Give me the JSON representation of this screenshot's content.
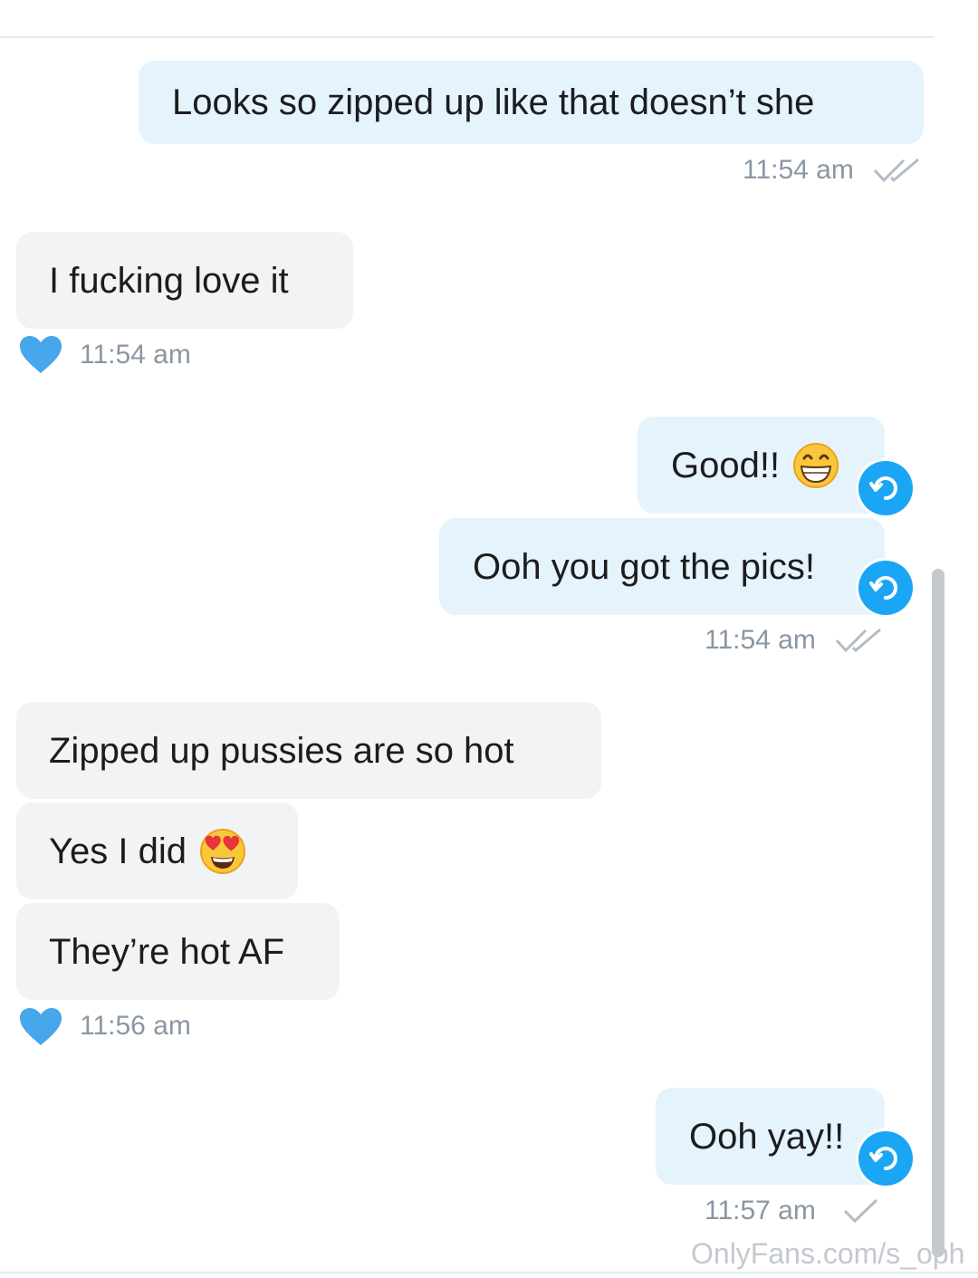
{
  "messages": {
    "m1": {
      "text": "Looks so zipped up like that doesn’t she",
      "time": "11:54 am"
    },
    "m2": {
      "text": "I fucking love it",
      "time": "11:54 am"
    },
    "m3": {
      "text": "Good!!",
      "emoji": "grinning-face-emoji"
    },
    "m4": {
      "text": "Ooh you got the pics!",
      "time": "11:54 am"
    },
    "m5": {
      "text": "Zipped up pussies are so hot"
    },
    "m6": {
      "text": "Yes I did",
      "emoji": "heart-eyes-emoji"
    },
    "m7": {
      "text": "They’re hot AF",
      "time": "11:56 am"
    },
    "m8": {
      "text": "Ooh yay!!",
      "time": "11:57 am"
    }
  },
  "icons": {
    "liked": "heart-icon",
    "unsend": "undo-icon",
    "read": "double-check-icon",
    "sent": "single-check-icon"
  },
  "colors": {
    "outgoing_bubble": "#e5f3fd",
    "incoming_bubble": "#f2f3f5",
    "accent": "#1aa6f5",
    "heart": "#46a7ea",
    "timestamp": "#8a96a3"
  },
  "watermark": "OnlyFans.com/s_oph"
}
